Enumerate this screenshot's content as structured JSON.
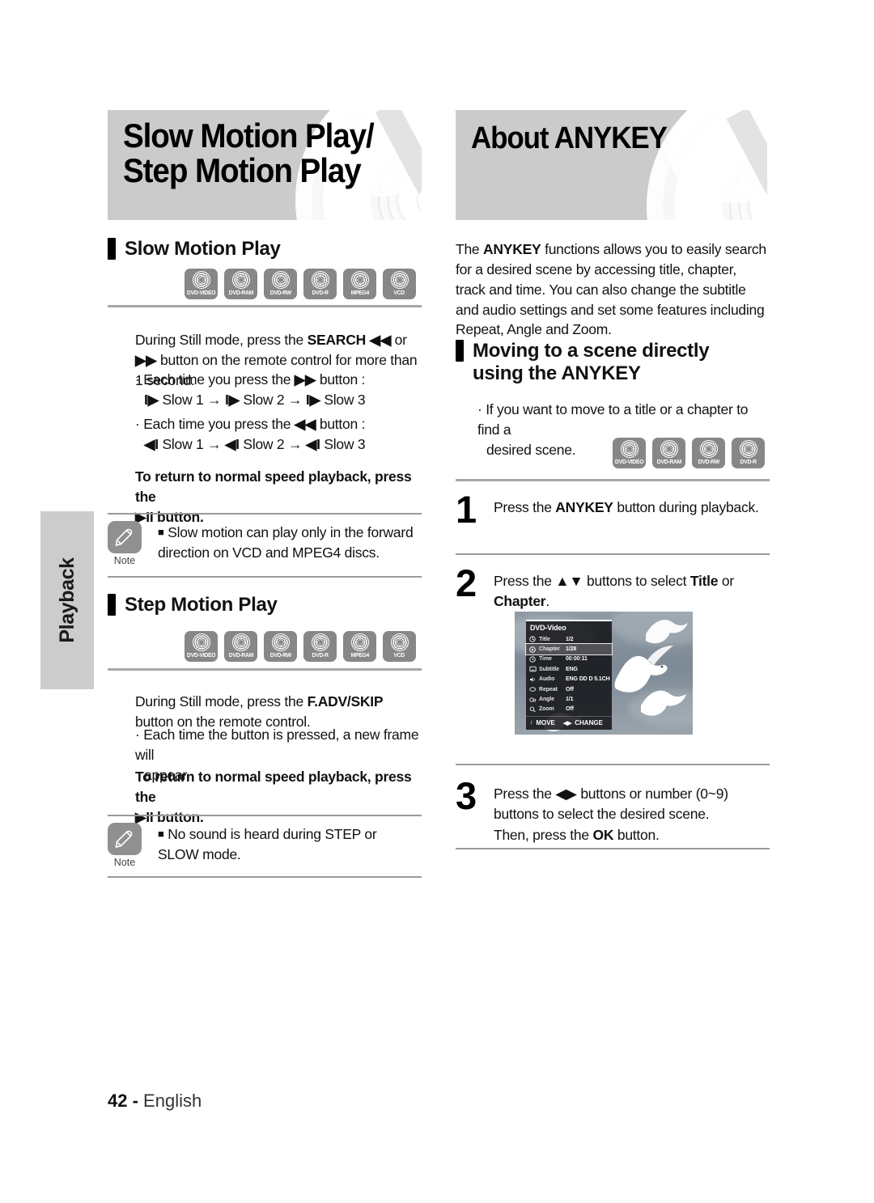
{
  "sidebar": {
    "tab_label": "Playback"
  },
  "footer": {
    "page_number": "42",
    "separator": "-",
    "language": "English"
  },
  "left_column": {
    "banner_title": "Slow Motion Play/\nStep Motion Play",
    "sections": [
      {
        "heading": "Slow Motion Play",
        "disc_icons": [
          "DVD-VIDEO",
          "DVD-RAM",
          "DVD-RW",
          "DVD-R",
          "MPEG4",
          "VCD"
        ],
        "intro": "During Still mode, press the SEARCH ◀◀ or ▶▶ button on the remote control for more than 1 second.",
        "intro_bold": "SEARCH",
        "bullets": [
          {
            "line1": "• Each time you press the ▶▶ button :",
            "line2": "I▶ Slow 1 → I▶ Slow 2 → I▶ Slow 3"
          },
          {
            "line1": "• Each time you press the ◀◀ button :",
            "line2": "◀I Slow 1 → ◀I Slow 2 → ◀I Slow 3"
          }
        ],
        "return_note": "To return to normal speed playback, press the ▶II button.",
        "note": "Slow motion can play only in the forward direction on VCD and MPEG4 discs.",
        "note_label": "Note"
      },
      {
        "heading": "Step Motion Play",
        "disc_icons": [
          "DVD-VIDEO",
          "DVD-RAM",
          "DVD-RW",
          "DVD-R",
          "MPEG4",
          "VCD"
        ],
        "intro": "During Still mode, press the F.ADV/SKIP button on the remote control.",
        "intro_bold": "F.ADV/SKIP",
        "bullets": [
          {
            "line1": "• Each time the button is pressed, a new frame will",
            "line2": "appear."
          }
        ],
        "return_note": "To return to normal speed playback, press the ▶II button.",
        "note": "No sound is heard during STEP or SLOW mode.",
        "note_label": "Note"
      }
    ]
  },
  "right_column": {
    "banner_title": "About ANYKEY",
    "intro": "The ANYKEY functions allows you to easily search for a desired scene by accessing title, chapter, track and time. You can also change the subtitle and audio settings and set some features including Repeat, Angle and Zoom.",
    "intro_bold": "ANYKEY",
    "heading": "Moving to a scene directly using the ANYKEY",
    "bullet": "• If you want to move to a title or a chapter to find a desired scene.",
    "disc_icons": [
      "DVD-VIDEO",
      "DVD-RAM",
      "DVD-RW",
      "DVD-R"
    ],
    "steps": [
      {
        "number": "1",
        "text": "Press the ANYKEY button during playback.",
        "bold": [
          "ANYKEY"
        ]
      },
      {
        "number": "2",
        "text": "Press the ▲▼ buttons to select Title or Chapter.",
        "bold": [
          "Title",
          "Chapter"
        ]
      },
      {
        "number": "3",
        "text": "Press the ◀▶ buttons or number (0~9) buttons to select the desired scene.\nThen, press the OK button.",
        "bold": [
          "OK"
        ]
      }
    ]
  },
  "osd": {
    "title": "DVD-Video",
    "rows": [
      {
        "icon": "title-icon",
        "label": "Title",
        "value": "1/2",
        "selected": false
      },
      {
        "icon": "chapter-icon",
        "label": "Chapter",
        "value": "1/28",
        "selected": true
      },
      {
        "icon": "clock-icon",
        "label": "Time",
        "value": "00:00:11",
        "selected": false
      },
      {
        "icon": "subtitle-icon",
        "label": "Subtitle",
        "value": "ENG",
        "selected": false
      },
      {
        "icon": "speaker-icon",
        "label": "Audio",
        "value": "ENG DD D 5.1CH",
        "selected": false
      },
      {
        "icon": "repeat-icon",
        "label": "Repeat",
        "value": "Off",
        "selected": false
      },
      {
        "icon": "angle-icon",
        "label": "Angle",
        "value": "1/1",
        "selected": false
      },
      {
        "icon": "zoom-icon",
        "label": "Zoom",
        "value": "Off",
        "selected": false
      }
    ],
    "footer_move": "MOVE",
    "footer_change": "CHANGE",
    "footer_move_glyph": "↕",
    "footer_change_glyph": "◀▶"
  },
  "colors": {
    "banner_bg": "#cbcbcb",
    "tab_bg": "#cccccc",
    "disc_icon_bg": "#878787",
    "rule": "#a8a8a8",
    "note_icon_bg": "#909090"
  }
}
